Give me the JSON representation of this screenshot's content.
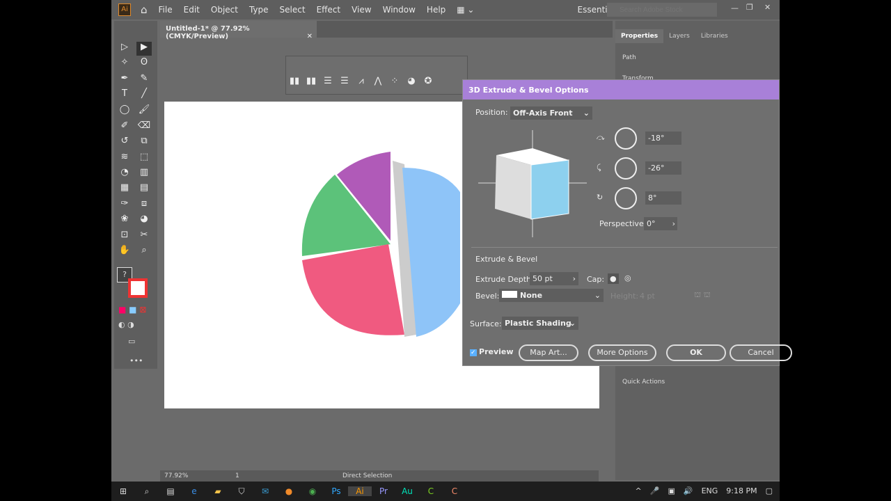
{
  "menu": {
    "items": [
      "File",
      "Edit",
      "Object",
      "Type",
      "Select",
      "Effect",
      "View",
      "Window",
      "Help"
    ],
    "workspace": "Essentials",
    "search_placeholder": "Search Adobe Stock"
  },
  "document": {
    "tab": "Untitled-1* @ 77.92% (CMYK/Preview)"
  },
  "right_panel": {
    "tabs": [
      "Properties",
      "Layers",
      "Libraries"
    ],
    "path": "Path",
    "transform": "Transform",
    "quick_actions": "Quick Actions"
  },
  "dialog": {
    "title": "3D Extrude & Bevel Options",
    "position_label": "Position:",
    "position_value": "Off-Axis Front",
    "rot_x": "-18°",
    "rot_y": "-26°",
    "rot_z": "8°",
    "perspective_label": "Perspective:",
    "perspective_value": "0°",
    "section": "Extrude & Bevel",
    "depth_label": "Extrude Depth:",
    "depth_value": "50 pt",
    "cap_label": "Cap:",
    "bevel_label": "Bevel:",
    "bevel_value": "None",
    "height_label": "Height:",
    "height_value": "4 pt",
    "surface_label": "Surface:",
    "surface_value": "Plastic Shading",
    "preview_label": "Preview",
    "preview_checked": true,
    "buttons": {
      "map_art": "Map Art...",
      "more_options": "More Options",
      "ok": "OK",
      "cancel": "Cancel"
    },
    "title_color": "#a880d8"
  },
  "status": {
    "zoom": "77.92%",
    "artboard": "1",
    "tool": "Direct Selection"
  },
  "taskbar": {
    "lang": "ENG",
    "time": "9:18 PM"
  },
  "pie_colors": [
    "#b05ab8",
    "#5cc27a",
    "#f05a80",
    "#8ec4f8"
  ]
}
